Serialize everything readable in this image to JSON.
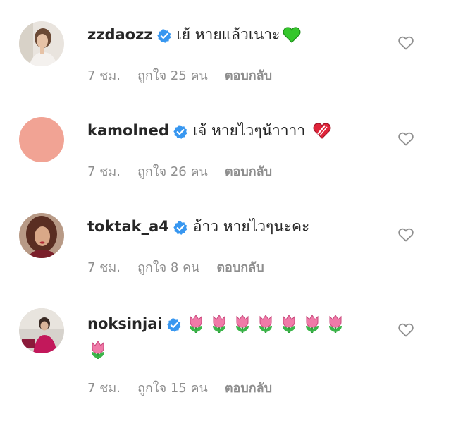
{
  "comments": [
    {
      "username": "zzdaozz",
      "text": "เย้ หายแล้วเนาะ",
      "emoji": "green-heart",
      "time": "7 ชม.",
      "likes": "ถูกใจ 25 คน",
      "reply": "ตอบกลับ"
    },
    {
      "username": "kamolned",
      "text": "เจ้ หายไวๆน้าาาา",
      "emoji": "mending-heart",
      "time": "7 ชม.",
      "likes": "ถูกใจ 26 คน",
      "reply": "ตอบกลับ"
    },
    {
      "username": "toktak_a4",
      "text": "อ้าว หายไวๆนะคะ",
      "time": "7 ชม.",
      "likes": "ถูกใจ 8 คน",
      "reply": "ตอบกลับ"
    },
    {
      "username": "noksinjai",
      "text": "",
      "emoji": "tulip",
      "emoji_count": 8,
      "time": "7 ชม.",
      "likes": "ถูกใจ 15 คน",
      "reply": "ตอบกลับ"
    }
  ],
  "colors": {
    "verified": "#3897f0",
    "meta_text": "#8e8e8e",
    "green_heart": "#35c72c",
    "red_heart": "#e0243a",
    "tulip_pink": "#f07aa8",
    "avatar_placeholder": "#f1a394"
  }
}
